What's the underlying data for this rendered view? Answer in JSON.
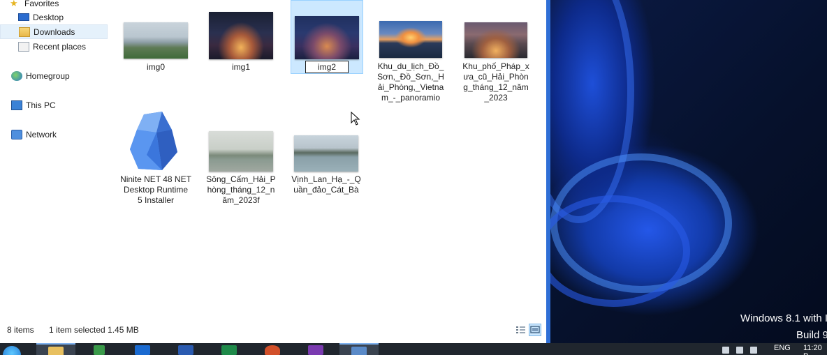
{
  "nav": {
    "favorites": "Favorites",
    "desktop": "Desktop",
    "downloads": "Downloads",
    "recent": "Recent places",
    "homegroup": "Homegroup",
    "this_pc": "This PC",
    "network": "Network"
  },
  "files": [
    {
      "name": "img0"
    },
    {
      "name": "img1"
    },
    {
      "name": "img2"
    },
    {
      "name": "Khu_du_lịch_Đồ_Sơn,_Đồ_Sơn,_Hải_Phòng,_Vietnam_-_panoramio"
    },
    {
      "name": "Khu_phố_Pháp_xưa_cũ_Hải_Phòng_tháng_12_năm_2023"
    },
    {
      "name": "Ninite NET 48 NET Desktop Runtime 5 Installer"
    },
    {
      "name": "Sông_Cấm_Hải_Phòng_tháng_12_năm_2023f"
    },
    {
      "name": "Vịnh_Lan_Hạ_-_Quần_đảo_Cát_Bà"
    }
  ],
  "status": {
    "count": "8 items",
    "selection": "1 item selected  1.45 MB"
  },
  "desktop": {
    "watermark_line1": "Windows 8.1 with I",
    "watermark_line2": "Build 9"
  },
  "tray": {
    "lang": "ENG",
    "time": "11:20 P"
  },
  "colors": {
    "accent": "#2f6fd6",
    "selection": "#cce8ff",
    "taskbar": "#20262e"
  }
}
